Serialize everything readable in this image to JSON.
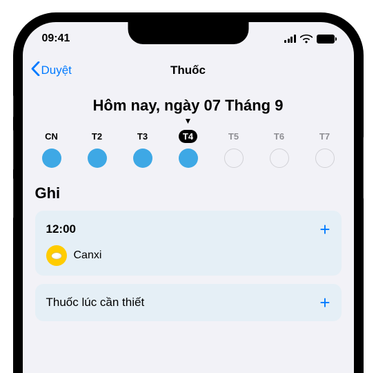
{
  "statusBar": {
    "time": "09:41"
  },
  "nav": {
    "back": "Duyệt",
    "title": "Thuốc"
  },
  "dateHeader": "Hôm nay, ngày 07 Tháng 9",
  "week": [
    {
      "label": "CN",
      "state": "past",
      "filled": true
    },
    {
      "label": "T2",
      "state": "past",
      "filled": true
    },
    {
      "label": "T3",
      "state": "past",
      "filled": true
    },
    {
      "label": "T4",
      "state": "today",
      "filled": true
    },
    {
      "label": "T5",
      "state": "future",
      "filled": false
    },
    {
      "label": "T6",
      "state": "future",
      "filled": false
    },
    {
      "label": "T7",
      "state": "future",
      "filled": false
    }
  ],
  "section": {
    "title": "Ghi"
  },
  "cards": {
    "scheduled": {
      "time": "12:00",
      "med": "Canxi"
    },
    "asNeeded": {
      "title": "Thuốc lúc cần thiết"
    }
  }
}
